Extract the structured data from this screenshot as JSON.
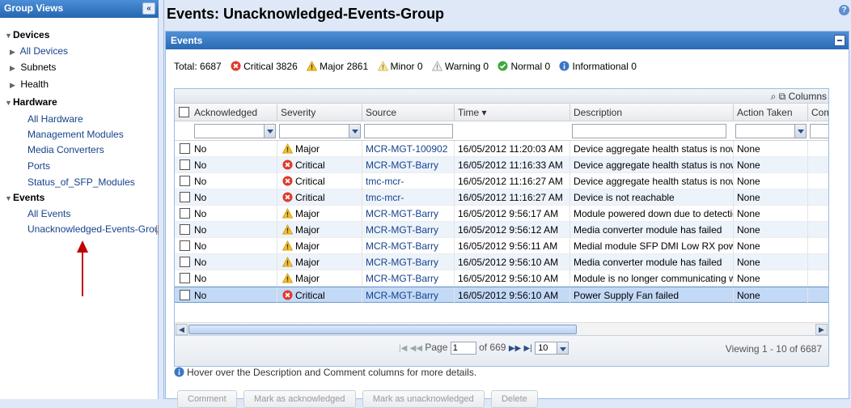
{
  "left_panel": {
    "title": "Group Views",
    "collapse_glyph": "«",
    "tree": {
      "devices": {
        "label": "Devices",
        "items": [
          "All Devices",
          "Subnets",
          "Health"
        ]
      },
      "hardware": {
        "label": "Hardware",
        "items": [
          "All Hardware",
          "Management Modules",
          "Media Converters",
          "Ports",
          "Status_of_SFP_Modules"
        ]
      },
      "events": {
        "label": "Events",
        "items": [
          "All Events",
          "Unacknowledged-Events-Grou"
        ]
      }
    },
    "annotation_color": "#c00000"
  },
  "main": {
    "title": "Events: Unacknowledged-Events-Group",
    "help_glyph": "?",
    "panel_title": "Events",
    "summary": {
      "total": "Total: 6687",
      "critical": "Critical 3826",
      "major": "Major 2861",
      "minor": "Minor 0",
      "warning": "Warning 0",
      "normal": "Normal 0",
      "informational": "Informational 0"
    },
    "columns_tool": "Columns",
    "columns": [
      "Acknowledged",
      "Severity",
      "Source",
      "Time ▾",
      "Description",
      "Action Taken",
      "Com"
    ],
    "rows": [
      {
        "ack": "No",
        "severity": "Major",
        "source": "MCR-MGT-100902",
        "time": "16/05/2012 11:20:03 AM",
        "description": "Device aggregate health status is now",
        "action": "None"
      },
      {
        "ack": "No",
        "severity": "Critical",
        "source": "MCR-MGT-Barry",
        "time": "16/05/2012 11:16:33 AM",
        "description": "Device aggregate health status is now",
        "action": "None"
      },
      {
        "ack": "No",
        "severity": "Critical",
        "source": "tmc-mcr-",
        "time": "16/05/2012 11:16:27 AM",
        "description": "Device aggregate health status is now",
        "action": "None"
      },
      {
        "ack": "No",
        "severity": "Critical",
        "source": "tmc-mcr-",
        "time": "16/05/2012 11:16:27 AM",
        "description": "Device is not reachable",
        "action": "None"
      },
      {
        "ack": "No",
        "severity": "Major",
        "source": "MCR-MGT-Barry",
        "time": "16/05/2012 9:56:17 AM",
        "description": "Module powered down due to detectio",
        "action": "None"
      },
      {
        "ack": "No",
        "severity": "Major",
        "source": "MCR-MGT-Barry",
        "time": "16/05/2012 9:56:12 AM",
        "description": "Media converter module has failed",
        "action": "None"
      },
      {
        "ack": "No",
        "severity": "Major",
        "source": "MCR-MGT-Barry",
        "time": "16/05/2012 9:56:11 AM",
        "description": "Medial module SFP DMI Low RX powe",
        "action": "None"
      },
      {
        "ack": "No",
        "severity": "Major",
        "source": "MCR-MGT-Barry",
        "time": "16/05/2012 9:56:10 AM",
        "description": "Media converter module has failed",
        "action": "None"
      },
      {
        "ack": "No",
        "severity": "Major",
        "source": "MCR-MGT-Barry",
        "time": "16/05/2012 9:56:10 AM",
        "description": "Module is no longer communicating w",
        "action": "None"
      },
      {
        "ack": "No",
        "severity": "Critical",
        "source": "MCR-MGT-Barry",
        "time": "16/05/2012 9:56:10 AM",
        "description": "Power Supply Fan failed",
        "action": "None"
      }
    ],
    "selected_row": 9,
    "pager": {
      "page_label": "Page",
      "page_value": "1",
      "of_label": "of 669",
      "per_page": "10",
      "viewing": "Viewing 1 - 10 of 6687"
    },
    "hint": "Hover over the Description and Comment columns for more details.",
    "buttons": [
      "Comment",
      "Mark as acknowledged",
      "Mark as unacknowledged",
      "Delete"
    ]
  },
  "icons": {
    "critical": "critical-icon",
    "major": "major-warning-icon",
    "minor": "minor-warning-icon",
    "warning": "warning-icon",
    "normal": "normal-icon",
    "informational": "info-icon"
  },
  "colors": {
    "critical": "#e03a2c",
    "major": "#f2b51b",
    "normal": "#3fa83f",
    "info": "#3c77c6",
    "link": "#15428b",
    "header_blue": "#2a6ab4",
    "selected_row": "#c3daf7"
  }
}
